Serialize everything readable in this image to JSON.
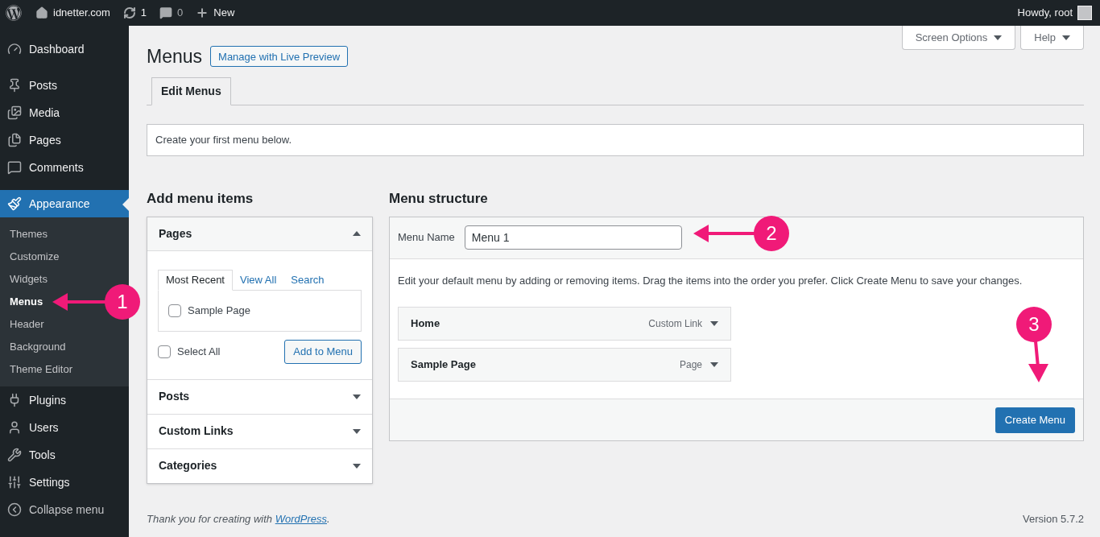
{
  "top_bar": {
    "site": "idnetter.com",
    "updates": "1",
    "comments": "0",
    "new": "New",
    "greeting": "Howdy, root"
  },
  "sidebar": {
    "sections": [
      {
        "items": [
          {
            "label": "Dashboard",
            "selected": false
          }
        ]
      },
      {
        "items": [
          {
            "label": "Posts",
            "selected": false
          },
          {
            "label": "Media",
            "selected": false
          },
          {
            "label": "Pages",
            "selected": false
          },
          {
            "label": "Comments",
            "selected": false
          }
        ]
      },
      {
        "items": [
          {
            "label": "Appearance",
            "selected": true,
            "children": [
              {
                "label": "Themes",
                "selected": false
              },
              {
                "label": "Customize",
                "selected": false
              },
              {
                "label": "Widgets",
                "selected": false
              },
              {
                "label": "Menus",
                "selected": true
              },
              {
                "label": "Header",
                "selected": false
              },
              {
                "label": "Background",
                "selected": false
              },
              {
                "label": "Theme Editor",
                "selected": false
              }
            ]
          },
          {
            "label": "Plugins",
            "selected": false
          },
          {
            "label": "Users",
            "selected": false
          },
          {
            "label": "Tools",
            "selected": false
          },
          {
            "label": "Settings",
            "selected": false
          }
        ]
      }
    ],
    "collapse": "Collapse menu"
  },
  "screen_options": "Screen Options",
  "help": "Help",
  "title": "Menus",
  "live_preview_button": "Manage with Live Preview",
  "tabs": [
    {
      "label": "Edit Menus",
      "selected": true
    }
  ],
  "notice": "Create your first menu below.",
  "add_items": {
    "heading": "Add menu items",
    "sections": [
      {
        "title": "Pages",
        "expanded": true,
        "tabs": [
          {
            "label": "Most Recent",
            "selected": true
          },
          {
            "label": "View All",
            "selected": false
          },
          {
            "label": "Search",
            "selected": false
          }
        ],
        "items": [
          {
            "label": "Sample Page",
            "checked": false
          }
        ],
        "select_all": {
          "label": "Select All",
          "checked": false
        },
        "button": "Add to Menu"
      },
      {
        "title": "Posts",
        "expanded": false
      },
      {
        "title": "Custom Links",
        "expanded": false
      },
      {
        "title": "Categories",
        "expanded": false
      }
    ]
  },
  "structure": {
    "heading": "Menu structure",
    "name_label": "Menu Name",
    "name_value": "Menu 1",
    "instructions": "Edit your default menu by adding or removing items. Drag the items into the order you prefer. Click Create Menu to save your changes.",
    "items": [
      {
        "title": "Home",
        "type": "Custom Link"
      },
      {
        "title": "Sample Page",
        "type": "Page"
      }
    ],
    "button": "Create Menu"
  },
  "footer": {
    "before": "Thank you for creating with ",
    "link": "WordPress",
    "after": "."
  },
  "version": "Version 5.7.2",
  "annotations": [
    {
      "number": "1"
    },
    {
      "number": "2"
    },
    {
      "number": "3"
    }
  ]
}
